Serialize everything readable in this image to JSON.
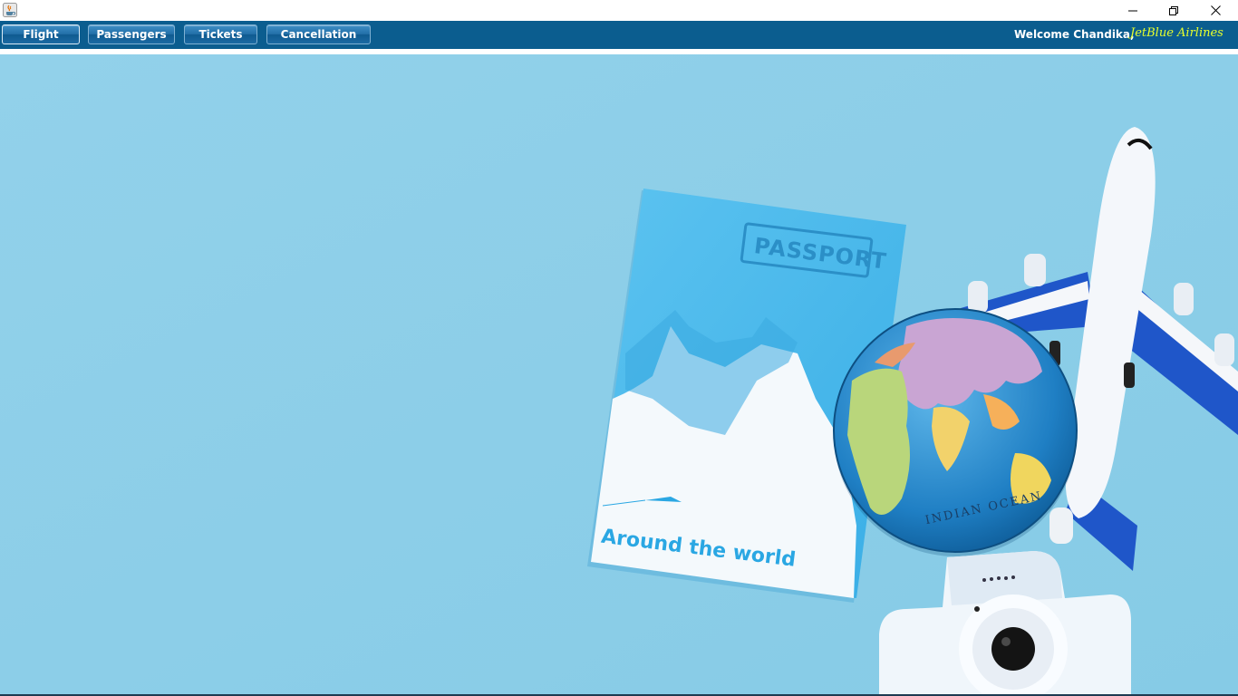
{
  "window": {
    "app_icon": "java-cup-icon",
    "controls": [
      "minimize-icon",
      "restore-icon",
      "close-icon"
    ]
  },
  "menu": {
    "items": [
      {
        "label": "Flight",
        "active": true
      },
      {
        "label": "Passengers"
      },
      {
        "label": "Tickets"
      },
      {
        "label": "Cancellation"
      }
    ],
    "welcome": "Welcome Chandika,",
    "brand": "JetBlue Airlines"
  },
  "background": {
    "passport_emboss": "PASSPORT",
    "passport_caption": "Around the world",
    "globe_label": "INDIAN OCEAN"
  },
  "colors": {
    "menubar": "#0b5d8f",
    "button": "#226fa8",
    "brand_text": "#e7ff2c",
    "backdrop": "#8fd0ea"
  }
}
